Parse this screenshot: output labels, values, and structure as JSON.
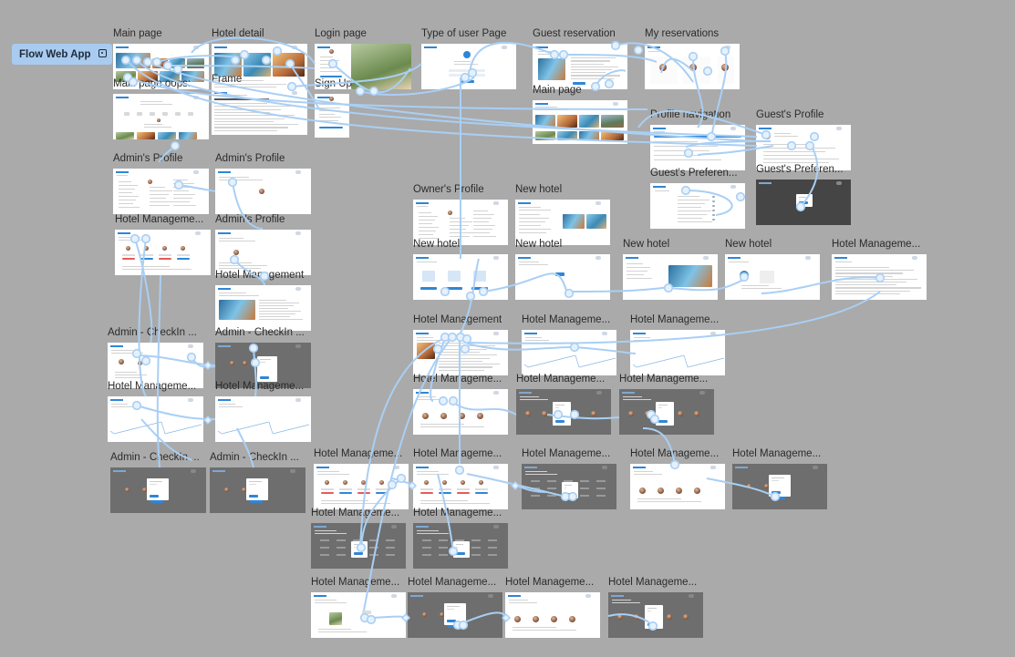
{
  "flow_tag": {
    "label": "Flow Web App",
    "icon": "frame-icon"
  },
  "colors": {
    "canvas": "#aaaaaa",
    "wire": "#a9cff4",
    "wire_dot": "#e6f1fc",
    "frame_bg": "#ffffff",
    "overlay_bg": "#6e6e6e",
    "brand": "#2f86d6"
  },
  "screens": [
    {
      "label": "Main page",
      "kind": "hero"
    },
    {
      "label": "Hotel detail",
      "kind": "detail"
    },
    {
      "label": "Login page",
      "kind": "login"
    },
    {
      "label": "Type of user Page",
      "kind": "type"
    },
    {
      "label": "Guest reservation",
      "kind": "reserve"
    },
    {
      "label": "My reservations",
      "kind": "myres"
    },
    {
      "label": "Main page oops:",
      "kind": "oops"
    },
    {
      "label": "Frame",
      "kind": "frame"
    },
    {
      "label": "Sign Up",
      "kind": "signup"
    },
    {
      "label": "Main page",
      "kind": "hero2"
    },
    {
      "label": "Profile navigation",
      "kind": "profnav"
    },
    {
      "label": "Guest's Profile",
      "kind": "guestprof"
    },
    {
      "label": "Guest's Preferen...",
      "kind": "pref"
    },
    {
      "label": "Guest's Preferen...",
      "kind": "prefdark"
    },
    {
      "label": "Admin's Profile",
      "kind": "form"
    },
    {
      "label": "Admin's Profile",
      "kind": "admin2"
    },
    {
      "label": "Hotel Manageme...",
      "kind": "cards"
    },
    {
      "label": "Admin's Profile",
      "kind": "admin3"
    },
    {
      "label": "Hotel Management",
      "kind": "hm"
    },
    {
      "label": "Owner's Profile",
      "kind": "form"
    },
    {
      "label": "New hotel",
      "kind": "newhotel1"
    },
    {
      "label": "New hotel",
      "kind": "newtype"
    },
    {
      "label": "New hotel",
      "kind": "newsimple"
    },
    {
      "label": "New hotel",
      "kind": "newphoto"
    },
    {
      "label": "New hotel",
      "kind": "newrooms"
    },
    {
      "label": "Hotel Manageme...",
      "kind": "text"
    },
    {
      "label": "Admin - CheckIn ...",
      "kind": "checkin"
    },
    {
      "label": "Admin - CheckIn ...",
      "kind": "checkinmodal"
    },
    {
      "label": "Hotel Manageme...",
      "kind": "chart"
    },
    {
      "label": "Hotel Manageme...",
      "kind": "chart"
    },
    {
      "label": "Admin - CheckIn ...",
      "kind": "modalsm"
    },
    {
      "label": "Admin - CheckIn ...",
      "kind": "modalsm"
    },
    {
      "label": "Hotel Management",
      "kind": "hm2"
    },
    {
      "label": "Hotel Manageme...",
      "kind": "chart"
    },
    {
      "label": "Hotel Manageme...",
      "kind": "chart"
    },
    {
      "label": "Hotel Manageme...",
      "kind": "avatars"
    },
    {
      "label": "Hotel Manageme...",
      "kind": "avatarsdark"
    },
    {
      "label": "Hotel Manageme...",
      "kind": "avatarsdark"
    },
    {
      "label": "Hotel Manageme...",
      "kind": "cards"
    },
    {
      "label": "Hotel Manageme...",
      "kind": "cards"
    },
    {
      "label": "Hotel Manageme...",
      "kind": "griddark"
    },
    {
      "label": "Hotel Manageme...",
      "kind": "avatars"
    },
    {
      "label": "Hotel Manageme...",
      "kind": "modalsm"
    },
    {
      "label": "Hotel Manageme...",
      "kind": "griddark"
    },
    {
      "label": "Hotel Manageme...",
      "kind": "griddark"
    },
    {
      "label": "Hotel Manageme...",
      "kind": "photo"
    },
    {
      "label": "Hotel Manageme...",
      "kind": "modalsm"
    },
    {
      "label": "Hotel Manageme...",
      "kind": "avatars"
    },
    {
      "label": "Hotel Manageme...",
      "kind": "avatarsdark"
    }
  ]
}
